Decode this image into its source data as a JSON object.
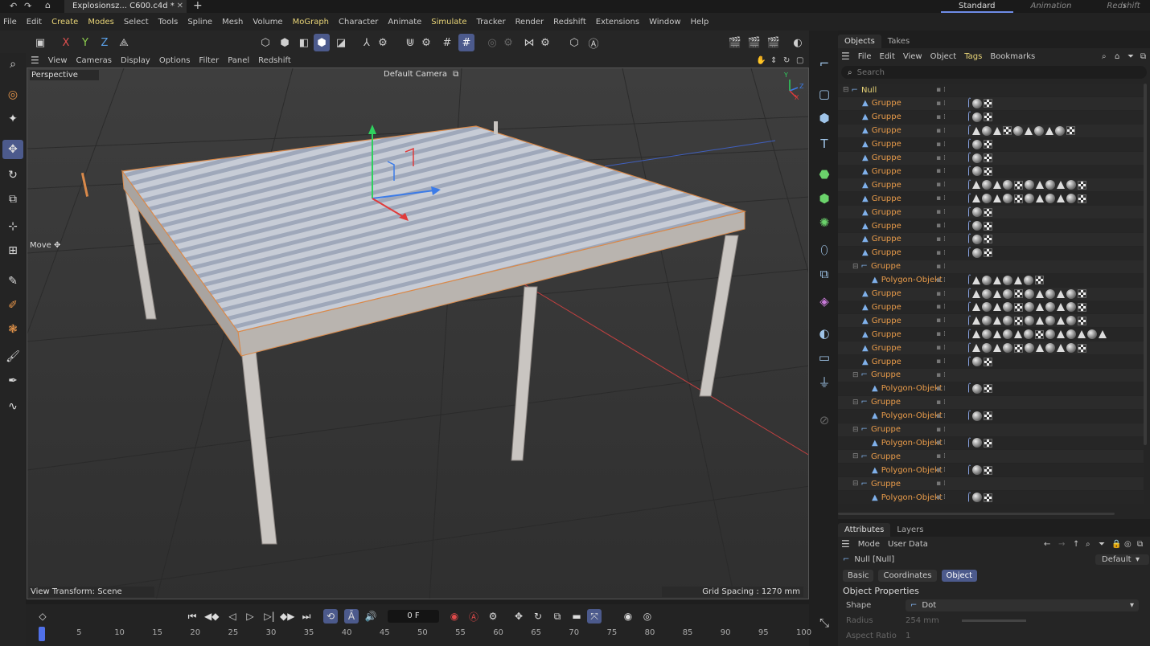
{
  "title_tab": "Explosionsz... C600.c4d *",
  "layouts": [
    "Standard",
    "Animation",
    "Redshift"
  ],
  "menu": [
    "File",
    "Edit",
    "Create",
    "Modes",
    "Select",
    "Tools",
    "Spline",
    "Mesh",
    "Volume",
    "MoGraph",
    "Character",
    "Animate",
    "Simulate",
    "Tracker",
    "Render",
    "Redshift",
    "Extensions",
    "Window",
    "Help"
  ],
  "axis_labels": [
    "X",
    "Y",
    "Z"
  ],
  "viewport_menu": [
    "View",
    "Cameras",
    "Display",
    "Options",
    "Filter",
    "Panel",
    "Redshift"
  ],
  "viewport": {
    "view_name": "Perspective",
    "camera": "Default Camera",
    "tool": "Move",
    "view_transform": "View Transform: Scene",
    "grid_spacing": "Grid Spacing : 1270 mm"
  },
  "timeline": {
    "frame": "0 F",
    "ticks": [
      "0",
      "5",
      "10",
      "15",
      "20",
      "25",
      "30",
      "35",
      "40",
      "45",
      "50",
      "55",
      "60",
      "65",
      "70",
      "75",
      "80",
      "85",
      "90",
      "95",
      "100"
    ]
  },
  "objects_panel": {
    "tabs": [
      "Objects",
      "Takes"
    ],
    "menu": [
      "File",
      "Edit",
      "View",
      "Object",
      "Tags",
      "Bookmarks"
    ],
    "search_placeholder": "Search",
    "rows": [
      {
        "name": "Null",
        "depth": 0,
        "type": "null",
        "tags": ""
      },
      {
        "name": "Gruppe",
        "depth": 1,
        "type": "poly",
        "tags": "a"
      },
      {
        "name": "Gruppe",
        "depth": 1,
        "type": "poly",
        "tags": "a"
      },
      {
        "name": "Gruppe",
        "depth": 1,
        "type": "poly",
        "tags": "c"
      },
      {
        "name": "Gruppe",
        "depth": 1,
        "type": "poly",
        "tags": "a"
      },
      {
        "name": "Gruppe",
        "depth": 1,
        "type": "poly",
        "tags": "a"
      },
      {
        "name": "Gruppe",
        "depth": 1,
        "type": "poly",
        "tags": "a"
      },
      {
        "name": "Gruppe",
        "depth": 1,
        "type": "poly",
        "tags": "d"
      },
      {
        "name": "Gruppe",
        "depth": 1,
        "type": "poly",
        "tags": "d"
      },
      {
        "name": "Gruppe",
        "depth": 1,
        "type": "poly",
        "tags": "a"
      },
      {
        "name": "Gruppe",
        "depth": 1,
        "type": "poly",
        "tags": "a"
      },
      {
        "name": "Gruppe",
        "depth": 1,
        "type": "poly",
        "tags": "a"
      },
      {
        "name": "Gruppe",
        "depth": 1,
        "type": "poly",
        "tags": "a"
      },
      {
        "name": "Gruppe",
        "depth": 1,
        "type": "null",
        "tags": ""
      },
      {
        "name": "Polygon-Objekt",
        "depth": 2,
        "type": "poly",
        "tags": "b"
      },
      {
        "name": "Gruppe",
        "depth": 1,
        "type": "poly",
        "tags": "d"
      },
      {
        "name": "Gruppe",
        "depth": 1,
        "type": "poly",
        "tags": "d"
      },
      {
        "name": "Gruppe",
        "depth": 1,
        "type": "poly",
        "tags": "d"
      },
      {
        "name": "Gruppe",
        "depth": 1,
        "type": "poly",
        "tags": "e"
      },
      {
        "name": "Gruppe",
        "depth": 1,
        "type": "poly",
        "tags": "d"
      },
      {
        "name": "Gruppe",
        "depth": 1,
        "type": "poly",
        "tags": "a"
      },
      {
        "name": "Gruppe",
        "depth": 1,
        "type": "null",
        "tags": ""
      },
      {
        "name": "Polygon-Objekt",
        "depth": 2,
        "type": "poly",
        "tags": "a"
      },
      {
        "name": "Gruppe",
        "depth": 1,
        "type": "null",
        "tags": ""
      },
      {
        "name": "Polygon-Objekt",
        "depth": 2,
        "type": "poly",
        "tags": "a"
      },
      {
        "name": "Gruppe",
        "depth": 1,
        "type": "null",
        "tags": ""
      },
      {
        "name": "Polygon-Objekt",
        "depth": 2,
        "type": "poly",
        "tags": "a"
      },
      {
        "name": "Gruppe",
        "depth": 1,
        "type": "null",
        "tags": ""
      },
      {
        "name": "Polygon-Objekt",
        "depth": 2,
        "type": "poly",
        "tags": "a"
      },
      {
        "name": "Gruppe",
        "depth": 1,
        "type": "null",
        "tags": ""
      },
      {
        "name": "Polygon-Objekt",
        "depth": 2,
        "type": "poly",
        "tags": "a"
      }
    ]
  },
  "attributes_panel": {
    "tabs": [
      "Attributes",
      "Layers"
    ],
    "menu": [
      "Mode",
      "User Data"
    ],
    "object_name": "Null [Null]",
    "preset": "Default",
    "buttons": [
      "Basic",
      "Coordinates",
      "Object"
    ],
    "section": "Object Properties",
    "props": [
      {
        "label": "Shape",
        "value": "Dot"
      },
      {
        "label": "Radius",
        "value": "254 mm"
      },
      {
        "label": "Aspect Ratio",
        "value": "1"
      }
    ]
  }
}
